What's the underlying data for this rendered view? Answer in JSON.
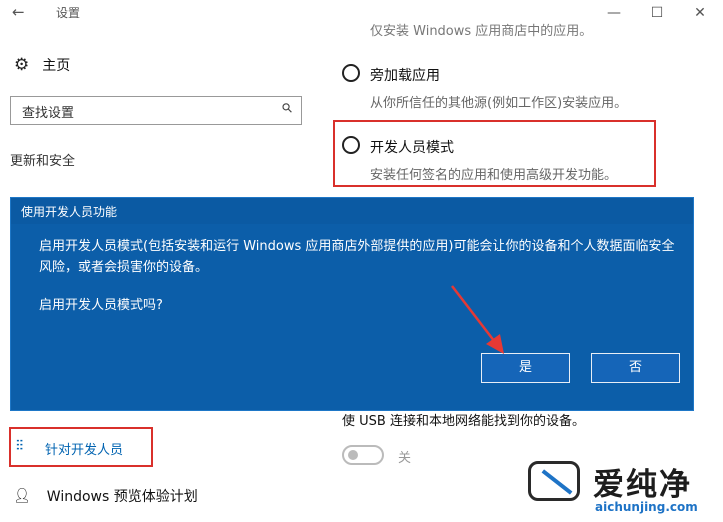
{
  "window": {
    "title": "设置",
    "back_icon": "arrow-left-icon",
    "controls": {
      "minimize": "—",
      "maximize": "☐",
      "close": "✕"
    }
  },
  "sidebar": {
    "home_label": "主页",
    "home_icon": "gear-icon",
    "search_placeholder": "查找设置",
    "section_title": "更新和安全",
    "items": [
      {
        "label": "针对开发人员",
        "icon": "developer-tools-icon",
        "selected": true
      },
      {
        "label": "Windows 预览体验计划",
        "icon": "user-icon",
        "selected": false
      }
    ]
  },
  "main": {
    "faded_top_text": "仅安装 Windows 应用商店中的应用。",
    "options": [
      {
        "title": "旁加载应用",
        "desc": "从你所信任的其他源(例如工作区)安装应用。"
      },
      {
        "title": "开发人员模式",
        "desc": "安装任何签名的应用和使用高级开发功能。"
      }
    ],
    "usb_text": "使 USB 连接和本地网络能找到你的设备。",
    "toggle_label": "关"
  },
  "dialog": {
    "title": "使用开发人员功能",
    "message": "启用开发人员模式(包括安装和运行 Windows 应用商店外部提供的应用)可能会让你的设备和个人数据面临安全风险，或者会损害你的设备。",
    "question": "启用开发人员模式吗?",
    "yes_label": "是",
    "no_label": "否"
  },
  "watermark": {
    "name": "爱纯净",
    "url": "aichunjing.com"
  },
  "colors": {
    "dialog_bg": "#0c5ea9",
    "accent": "#0063b1",
    "highlight_border": "#d9302b",
    "arrow": "#e53935"
  }
}
